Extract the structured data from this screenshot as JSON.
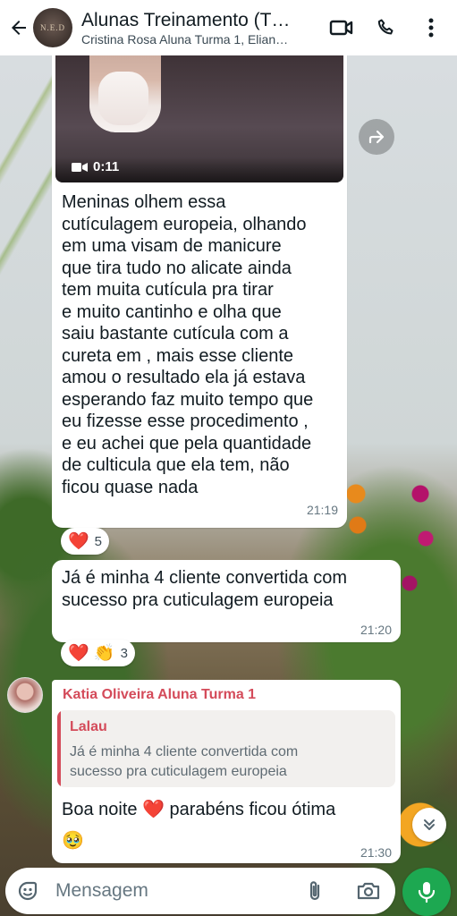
{
  "header": {
    "title": "Alunas Treinamento (T…",
    "subtitle": "Cristina Rosa Aluna Turma 1, Elian…",
    "avatar_text": "N.E.D"
  },
  "messages": [
    {
      "video_duration": "0:11",
      "text": "Meninas olhem essa\ncutículagem europeia, olhando\nem uma visam de manicure\nque tira tudo no alicate ainda\ntem muita cutícula pra tirar\ne muito cantinho e olha que\nsaiu bastante cutícula com a\ncureta em , mais esse cliente\namou o resultado ela já estava\nesperando faz muito tempo que\neu fizesse esse procedimento ,\ne eu achei que pela quantidade\nde culticula que ela tem, não\nficou quase nada",
      "time": "21:19",
      "reactions": {
        "emoji": "❤️",
        "count": "5"
      }
    },
    {
      "text": "Já é minha 4 cliente convertida com\nsucesso pra cuticulagem europeia",
      "time": "21:20",
      "reactions": {
        "emoji": "❤️ 👏",
        "count": "3"
      }
    },
    {
      "sender": "Katia Oliveira Aluna Turma 1",
      "quote_author": "Lalau",
      "quote_text": "Já é minha 4 cliente convertida com\nsucesso pra cuticulagem europeia",
      "text": "Boa noite ❤️ parabéns ficou ótima\n🥹",
      "time": "21:30"
    }
  ],
  "composer": {
    "placeholder": "Mensagem"
  },
  "icons": {
    "back": "arrow-left-icon",
    "video_call": "video-camera-icon",
    "voice_call": "phone-icon",
    "menu": "more-vertical-icon",
    "forward": "forward-icon",
    "scroll": "chevron-double-down-icon",
    "emoji": "sticker-icon",
    "attach": "paperclip-icon",
    "camera": "camera-icon",
    "mic": "microphone-icon"
  },
  "colors": {
    "accent": "#1da851",
    "sender": "#d44b5a",
    "header_bg": "#ffffff"
  }
}
